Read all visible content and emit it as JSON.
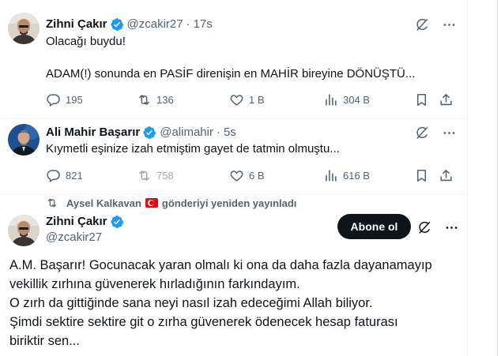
{
  "tweets": [
    {
      "display_name": "Zihni Çakır",
      "handle": "@zcakir27",
      "dot": "·",
      "time": "17s",
      "lines": [
        "Olacağı buydu!",
        "",
        "ADAM(!) sonunda en PASİF direnişin en MAHİR bireyine DÖNÜŞTÜ..."
      ],
      "replies": "195",
      "retweets": "136",
      "likes": "1 B",
      "views": "304 B"
    },
    {
      "display_name": "Ali Mahir Başarır",
      "handle": "@alimahir",
      "dot": "·",
      "time": "5s",
      "lines": [
        "Kıymetli eşinize izah etmiştim gayet de tatmin olmuştu..."
      ],
      "replies": "821",
      "retweets": "758",
      "likes": "6 B",
      "views": "616 B"
    }
  ],
  "retweet_context": {
    "name": "Aysel Kalkavan",
    "label": "gönderiyi yeniden yayınladı"
  },
  "main_tweet": {
    "display_name": "Zihni Çakır",
    "handle": "@zcakir27",
    "follow_label": "Abone ol",
    "lines": [
      "A.M. Başarır! Gocunacak yaran olmalı ki ona da daha fazla dayanamayıp",
      "vekillik zırhına güvenerek hırladığının farkındayım.",
      "O zırh da gittiğinde sana neyi nasıl izah edeceğimi Allah biliyor.",
      "Şimdi sektire sektire git o zırha güvenerek ödenecek hesap faturası",
      "biriktir sen..."
    ]
  },
  "colors": {
    "verified_blue": "#1d9bf0",
    "muted_text": "#536471",
    "text": "#0f1419",
    "follow_bg": "#0f1419"
  },
  "icons": {
    "reply": "reply-icon",
    "retweet": "retweet-icon",
    "like": "heart-icon",
    "views": "views-chart-icon",
    "bookmark": "bookmark-icon",
    "share": "share-icon",
    "grok": "grok-icon",
    "more": "more-icon",
    "verified": "verified-badge-icon"
  }
}
